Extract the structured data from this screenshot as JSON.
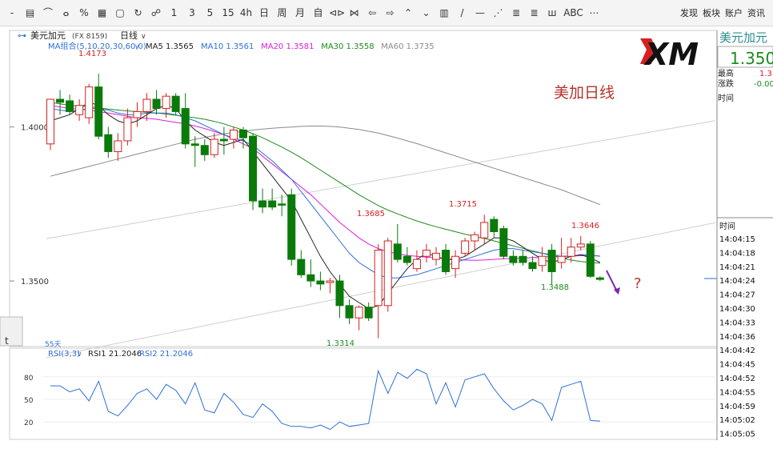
{
  "toolbar": {
    "items": [
      "-",
      "▤",
      "⌒",
      "ⴰ",
      "%",
      "▦",
      "▢",
      "↻",
      "☍",
      "1",
      "3",
      "5",
      "15",
      "4h",
      "日",
      "周",
      "月",
      "自",
      "⊲⊳",
      "⋈",
      "⇦",
      "⇨",
      "⌃",
      "⌄",
      "▥",
      "/",
      "—",
      "⋰",
      "≣",
      "≣",
      "ш",
      "ABC",
      "⋯"
    ],
    "right": [
      "发现",
      "板块",
      "账户",
      "资讯"
    ]
  },
  "header": {
    "title": "美元加元",
    "code": "(FX 8159)",
    "period": "日线"
  },
  "ma_legend": {
    "label": "MA组合(5,10,20,30,60,0)",
    "items": [
      {
        "text": "MA5 1.3565",
        "color": "#222222"
      },
      {
        "text": "MA10 1.3561",
        "color": "#2f6fd8"
      },
      {
        "text": "MA20 1.3581",
        "color": "#d81fd8"
      },
      {
        "text": "MA30 1.3558",
        "color": "#1e8a1e"
      },
      {
        "text": "MA60 1.3735",
        "color": "#8a8a8a"
      }
    ]
  },
  "price_axis": {
    "ticks": [
      "1.4000",
      "1.3500"
    ]
  },
  "annotations": {
    "high_label": "1.4173",
    "low_label": "1.3314",
    "mid_label": "1.3685",
    "peak_label": "1.3715",
    "right_label": "1.3646",
    "trough_label": "1.3488",
    "title": "美加日线",
    "question": "?",
    "days": "55天"
  },
  "logo": {
    "text": "XM"
  },
  "right_panel": {
    "name": "美元加元",
    "price": "1.350",
    "high_label": "最高",
    "high_val": "1.3",
    "chg_label": "涨跌",
    "chg_val": "-0.00",
    "time_label": "时间"
  },
  "time_panel": {
    "header": "时间",
    "times": [
      "14:04:15",
      "14:04:18",
      "14:04:21",
      "14:04:24",
      "14:04:27",
      "14:04:30",
      "14:04:33",
      "14:04:36",
      "14:04:42",
      "14:04:45",
      "14:04:52",
      "14:04:55",
      "14:04:59",
      "14:05:02",
      "14:05:05"
    ]
  },
  "rsi": {
    "label": "RSI(3,3)",
    "rsi1": "RSI1 21.2046",
    "rsi2": "RSI2 21.2046",
    "ticks": [
      "80",
      "50",
      "20"
    ],
    "series_color": "#2f6fd8"
  },
  "side_tab": {
    "text": "t"
  },
  "chart_data": {
    "type": "candlestick",
    "ylim": [
      1.33,
      1.422
    ],
    "candles": [
      {
        "o": 1.3945,
        "h": 1.401,
        "l": 1.3925,
        "c": 1.409,
        "dir": "up"
      },
      {
        "o": 1.409,
        "h": 1.412,
        "l": 1.404,
        "c": 1.408,
        "dir": "down"
      },
      {
        "o": 1.4085,
        "h": 1.4105,
        "l": 1.404,
        "c": 1.405,
        "dir": "down"
      },
      {
        "o": 1.404,
        "h": 1.409,
        "l": 1.402,
        "c": 1.407,
        "dir": "up"
      },
      {
        "o": 1.403,
        "h": 1.414,
        "l": 1.401,
        "c": 1.413,
        "dir": "up"
      },
      {
        "o": 1.413,
        "h": 1.4173,
        "l": 1.396,
        "c": 1.397,
        "dir": "down"
      },
      {
        "o": 1.3975,
        "h": 1.4,
        "l": 1.39,
        "c": 1.392,
        "dir": "down"
      },
      {
        "o": 1.392,
        "h": 1.398,
        "l": 1.389,
        "c": 1.3955,
        "dir": "up"
      },
      {
        "o": 1.3955,
        "h": 1.406,
        "l": 1.394,
        "c": 1.403,
        "dir": "up"
      },
      {
        "o": 1.403,
        "h": 1.408,
        "l": 1.4,
        "c": 1.405,
        "dir": "up"
      },
      {
        "o": 1.405,
        "h": 1.411,
        "l": 1.402,
        "c": 1.409,
        "dir": "up"
      },
      {
        "o": 1.409,
        "h": 1.412,
        "l": 1.404,
        "c": 1.406,
        "dir": "down"
      },
      {
        "o": 1.406,
        "h": 1.411,
        "l": 1.403,
        "c": 1.41,
        "dir": "up"
      },
      {
        "o": 1.41,
        "h": 1.411,
        "l": 1.404,
        "c": 1.405,
        "dir": "down"
      },
      {
        "o": 1.406,
        "h": 1.411,
        "l": 1.393,
        "c": 1.3945,
        "dir": "down"
      },
      {
        "o": 1.3945,
        "h": 1.397,
        "l": 1.387,
        "c": 1.394,
        "dir": "down"
      },
      {
        "o": 1.394,
        "h": 1.396,
        "l": 1.389,
        "c": 1.391,
        "dir": "down"
      },
      {
        "o": 1.391,
        "h": 1.398,
        "l": 1.39,
        "c": 1.396,
        "dir": "up"
      },
      {
        "o": 1.396,
        "h": 1.4,
        "l": 1.391,
        "c": 1.3955,
        "dir": "down"
      },
      {
        "o": 1.396,
        "h": 1.4,
        "l": 1.393,
        "c": 1.399,
        "dir": "up"
      },
      {
        "o": 1.399,
        "h": 1.4,
        "l": 1.393,
        "c": 1.3965,
        "dir": "down"
      },
      {
        "o": 1.397,
        "h": 1.398,
        "l": 1.373,
        "c": 1.376,
        "dir": "down"
      },
      {
        "o": 1.376,
        "h": 1.38,
        "l": 1.372,
        "c": 1.374,
        "dir": "down"
      },
      {
        "o": 1.376,
        "h": 1.38,
        "l": 1.373,
        "c": 1.374,
        "dir": "down"
      },
      {
        "o": 1.375,
        "h": 1.378,
        "l": 1.371,
        "c": 1.375,
        "dir": "down"
      },
      {
        "o": 1.378,
        "h": 1.38,
        "l": 1.355,
        "c": 1.357,
        "dir": "down"
      },
      {
        "o": 1.357,
        "h": 1.36,
        "l": 1.351,
        "c": 1.352,
        "dir": "down"
      },
      {
        "o": 1.352,
        "h": 1.357,
        "l": 1.348,
        "c": 1.35,
        "dir": "down"
      },
      {
        "o": 1.35,
        "h": 1.353,
        "l": 1.347,
        "c": 1.349,
        "dir": "down"
      },
      {
        "o": 1.3495,
        "h": 1.351,
        "l": 1.346,
        "c": 1.35,
        "dir": "up"
      },
      {
        "o": 1.35,
        "h": 1.352,
        "l": 1.338,
        "c": 1.342,
        "dir": "down"
      },
      {
        "o": 1.342,
        "h": 1.344,
        "l": 1.336,
        "c": 1.338,
        "dir": "down"
      },
      {
        "o": 1.338,
        "h": 1.342,
        "l": 1.334,
        "c": 1.3415,
        "dir": "up"
      },
      {
        "o": 1.3415,
        "h": 1.343,
        "l": 1.337,
        "c": 1.338,
        "dir": "down"
      },
      {
        "o": 1.342,
        "h": 1.362,
        "l": 1.3314,
        "c": 1.36,
        "dir": "up"
      },
      {
        "o": 1.342,
        "h": 1.364,
        "l": 1.34,
        "c": 1.363,
        "dir": "up"
      },
      {
        "o": 1.362,
        "h": 1.3685,
        "l": 1.356,
        "c": 1.357,
        "dir": "down"
      },
      {
        "o": 1.358,
        "h": 1.361,
        "l": 1.355,
        "c": 1.356,
        "dir": "down"
      },
      {
        "o": 1.354,
        "h": 1.36,
        "l": 1.353,
        "c": 1.357,
        "dir": "up"
      },
      {
        "o": 1.358,
        "h": 1.362,
        "l": 1.356,
        "c": 1.36,
        "dir": "up"
      },
      {
        "o": 1.357,
        "h": 1.361,
        "l": 1.355,
        "c": 1.359,
        "dir": "up"
      },
      {
        "o": 1.36,
        "h": 1.362,
        "l": 1.352,
        "c": 1.353,
        "dir": "down"
      },
      {
        "o": 1.354,
        "h": 1.36,
        "l": 1.351,
        "c": 1.358,
        "dir": "up"
      },
      {
        "o": 1.359,
        "h": 1.364,
        "l": 1.358,
        "c": 1.363,
        "dir": "up"
      },
      {
        "o": 1.363,
        "h": 1.366,
        "l": 1.36,
        "c": 1.365,
        "dir": "up"
      },
      {
        "o": 1.364,
        "h": 1.3715,
        "l": 1.362,
        "c": 1.369,
        "dir": "up"
      },
      {
        "o": 1.37,
        "h": 1.371,
        "l": 1.364,
        "c": 1.366,
        "dir": "down"
      },
      {
        "o": 1.367,
        "h": 1.368,
        "l": 1.357,
        "c": 1.358,
        "dir": "down"
      },
      {
        "o": 1.358,
        "h": 1.36,
        "l": 1.355,
        "c": 1.356,
        "dir": "down"
      },
      {
        "o": 1.358,
        "h": 1.36,
        "l": 1.355,
        "c": 1.356,
        "dir": "down"
      },
      {
        "o": 1.356,
        "h": 1.358,
        "l": 1.353,
        "c": 1.354,
        "dir": "down"
      },
      {
        "o": 1.355,
        "h": 1.361,
        "l": 1.353,
        "c": 1.358,
        "dir": "up"
      },
      {
        "o": 1.36,
        "h": 1.362,
        "l": 1.3488,
        "c": 1.353,
        "dir": "down"
      },
      {
        "o": 1.356,
        "h": 1.364,
        "l": 1.354,
        "c": 1.358,
        "dir": "up"
      },
      {
        "o": 1.358,
        "h": 1.364,
        "l": 1.356,
        "c": 1.361,
        "dir": "up"
      },
      {
        "o": 1.361,
        "h": 1.3646,
        "l": 1.36,
        "c": 1.362,
        "dir": "up"
      },
      {
        "o": 1.362,
        "h": 1.363,
        "l": 1.351,
        "c": 1.3515,
        "dir": "down"
      },
      {
        "o": 1.351,
        "h": 1.3515,
        "l": 1.35,
        "c": 1.3505,
        "dir": "down"
      }
    ],
    "ma5": [
      1.402,
      1.403,
      1.404,
      1.406,
      1.408,
      1.407,
      1.404,
      1.402,
      1.401,
      1.402,
      1.404,
      1.406,
      1.407,
      1.406,
      1.402,
      1.399,
      1.397,
      1.395,
      1.394,
      1.395,
      1.396,
      1.392,
      1.388,
      1.384,
      1.38,
      1.376,
      1.37,
      1.364,
      1.358,
      1.353,
      1.349,
      1.345,
      1.343,
      1.341,
      1.342,
      1.346,
      1.35,
      1.354,
      1.357,
      1.359,
      1.358,
      1.357,
      1.357,
      1.358,
      1.36,
      1.362,
      1.364,
      1.364,
      1.363,
      1.361,
      1.359,
      1.357,
      1.356,
      1.357,
      1.358,
      1.3585,
      1.3575,
      1.356
    ],
    "ma10": [
      1.406,
      1.4055,
      1.405,
      1.4055,
      1.406,
      1.406,
      1.4055,
      1.4045,
      1.404,
      1.404,
      1.4045,
      1.4045,
      1.4045,
      1.404,
      1.403,
      1.402,
      1.4005,
      1.399,
      1.3975,
      1.3965,
      1.3955,
      1.394,
      1.3915,
      1.389,
      1.386,
      1.383,
      1.379,
      1.375,
      1.371,
      1.367,
      1.363,
      1.359,
      1.356,
      1.354,
      1.352,
      1.351,
      1.351,
      1.3515,
      1.352,
      1.353,
      1.354,
      1.355,
      1.356,
      1.357,
      1.358,
      1.359,
      1.36,
      1.3605,
      1.3605,
      1.36,
      1.3595,
      1.359,
      1.3585,
      1.358,
      1.358,
      1.3585,
      1.3585,
      1.358
    ],
    "ma20": [
      1.407,
      1.4065,
      1.406,
      1.4058,
      1.4055,
      1.405,
      1.4045,
      1.404,
      1.4035,
      1.403,
      1.4028,
      1.4025,
      1.402,
      1.4015,
      1.401,
      1.4003,
      1.3995,
      1.3985,
      1.3975,
      1.396,
      1.3945,
      1.393,
      1.3905,
      1.388,
      1.3855,
      1.383,
      1.3805,
      1.378,
      1.375,
      1.372,
      1.369,
      1.3665,
      1.364,
      1.362,
      1.3605,
      1.3595,
      1.3588,
      1.3583,
      1.358,
      1.3577,
      1.3575,
      1.3572,
      1.357,
      1.3568,
      1.3567,
      1.3568,
      1.357,
      1.3572,
      1.3573,
      1.3574,
      1.3576,
      1.3578,
      1.3579,
      1.358,
      1.3581,
      1.3582,
      1.3582,
      1.3581
    ],
    "ma30": [
      1.408,
      1.4075,
      1.407,
      1.4068,
      1.4066,
      1.4062,
      1.4058,
      1.4055,
      1.4052,
      1.405,
      1.4048,
      1.4045,
      1.4042,
      1.4038,
      1.4034,
      1.403,
      1.4025,
      1.4018,
      1.401,
      1.4,
      1.399,
      1.3978,
      1.3965,
      1.395,
      1.3935,
      1.3918,
      1.39,
      1.388,
      1.386,
      1.384,
      1.382,
      1.38,
      1.378,
      1.3762,
      1.3745,
      1.373,
      1.3718,
      1.3706,
      1.3695,
      1.3685,
      1.3676,
      1.3668,
      1.366,
      1.3652,
      1.3645,
      1.3638,
      1.363,
      1.3622,
      1.3614,
      1.3606,
      1.3598,
      1.359,
      1.3582,
      1.3575,
      1.3568,
      1.3563,
      1.356,
      1.3558
    ],
    "ma60": [
      1.384,
      1.3848,
      1.3856,
      1.3864,
      1.3872,
      1.388,
      1.3888,
      1.3896,
      1.3904,
      1.3912,
      1.392,
      1.3928,
      1.3936,
      1.3944,
      1.3952,
      1.396,
      1.3966,
      1.3972,
      1.3978,
      1.3982,
      1.3986,
      1.399,
      1.3993,
      1.3996,
      1.3998,
      1.4,
      1.4002,
      1.4003,
      1.4003,
      1.4002,
      1.4,
      1.3996,
      1.3992,
      1.3986,
      1.398,
      1.3972,
      1.3964,
      1.3955,
      1.3946,
      1.3936,
      1.3926,
      1.3916,
      1.3906,
      1.3896,
      1.3886,
      1.3876,
      1.3866,
      1.3856,
      1.3846,
      1.3836,
      1.3826,
      1.3816,
      1.3806,
      1.3796,
      1.3784,
      1.3772,
      1.376,
      1.3748
    ],
    "rsi_values": [
      68,
      68,
      60,
      64,
      48,
      74,
      34,
      28,
      42,
      58,
      64,
      50,
      70,
      62,
      44,
      72,
      36,
      32,
      58,
      46,
      30,
      26,
      44,
      34,
      18,
      14,
      14,
      12,
      16,
      10,
      20,
      14,
      16,
      18,
      88,
      58,
      86,
      78,
      90,
      84,
      44,
      72,
      40,
      76,
      80,
      84,
      64,
      48,
      36,
      42,
      50,
      44,
      22,
      66,
      70,
      74,
      22,
      21
    ],
    "rsi_ylim": [
      0,
      100
    ],
    "trend_channel_upper": [
      [
        20,
        1.375
      ],
      [
        58,
        1.396
      ]
    ],
    "trend_channel_lower": [
      [
        20,
        1.338
      ],
      [
        58,
        1.362
      ]
    ]
  }
}
